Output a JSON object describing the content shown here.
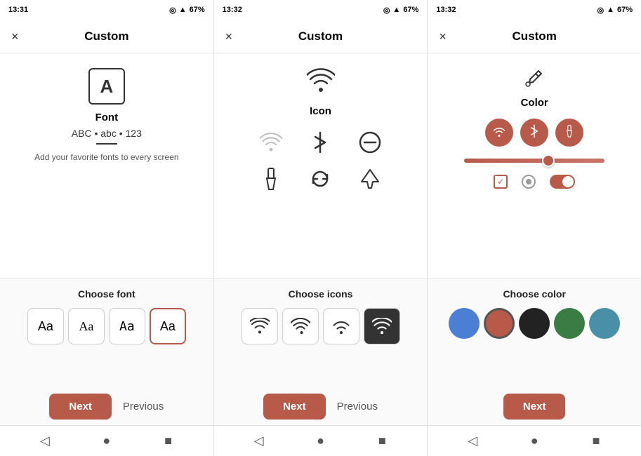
{
  "panels": [
    {
      "id": "font",
      "time": "13:31",
      "battery": "67%",
      "title": "Custom",
      "close_label": "×",
      "main_label": "Font",
      "sample_text": "ABC • abc • 123",
      "description": "Add your favorite fonts to every screen",
      "bottom_label": "Choose font",
      "font_options": [
        {
          "label": "Aa",
          "style": "normal",
          "selected": false
        },
        {
          "label": "Aa",
          "style": "serif",
          "selected": false
        },
        {
          "label": "Aa",
          "style": "mono",
          "selected": false
        },
        {
          "label": "Aa",
          "style": "selected",
          "selected": true
        }
      ],
      "btn_next": "Next",
      "btn_prev": "Previous"
    },
    {
      "id": "icon",
      "time": "13:32",
      "battery": "67%",
      "title": "Custom",
      "close_label": "×",
      "main_label": "Icon",
      "bottom_label": "Choose icons",
      "btn_next": "Next",
      "btn_prev": "Previous"
    },
    {
      "id": "color",
      "time": "13:32",
      "battery": "67%",
      "title": "Custom",
      "close_label": "×",
      "main_label": "Color",
      "bottom_label": "Choose color",
      "colors": [
        "#4a7fd4",
        "#b85a4a",
        "#222222",
        "#3a7d44",
        "#4a8fa8",
        "#c45"
      ],
      "btn_next": "Next"
    }
  ],
  "nav": {
    "back": "◁",
    "home": "●",
    "square": "■"
  }
}
